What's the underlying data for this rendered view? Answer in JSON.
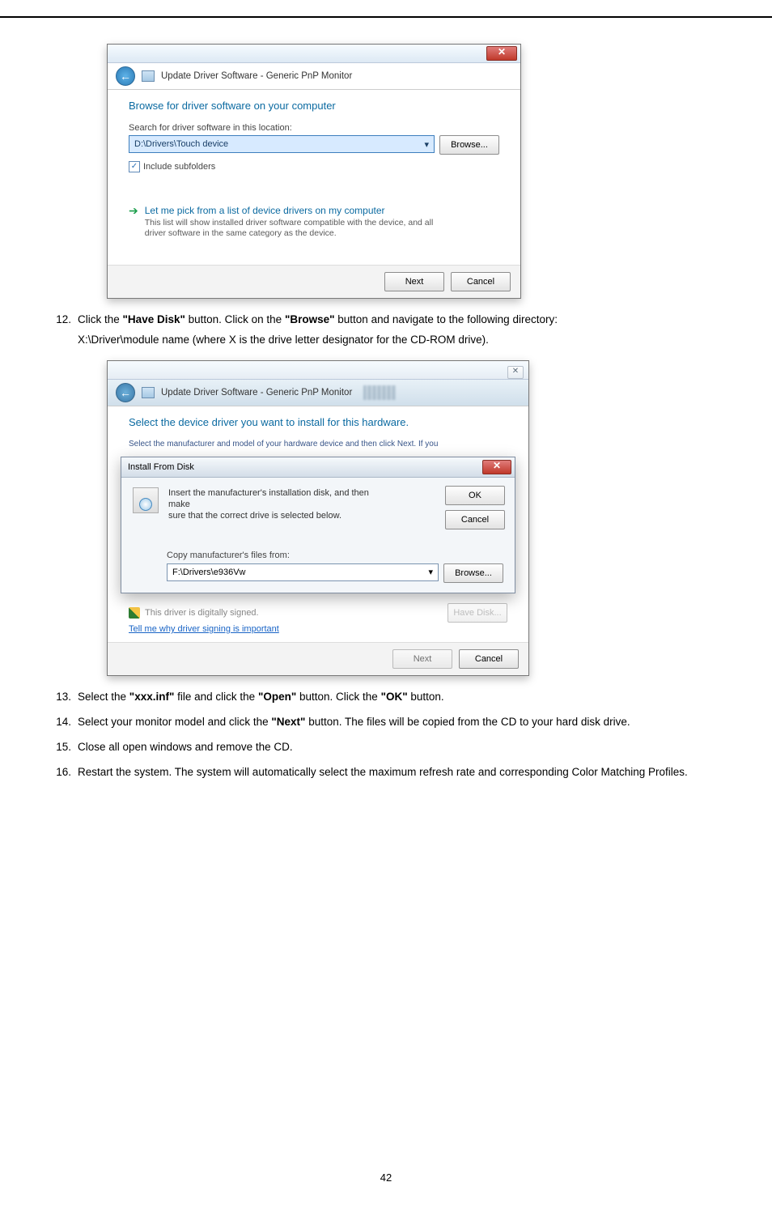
{
  "dlg1": {
    "title": "Update Driver Software - Generic PnP Monitor",
    "heading": "Browse for driver software on your computer",
    "search_label": "Search for driver software in this location:",
    "path": "D:\\Drivers\\Touch device",
    "browse": "Browse...",
    "include": "Include subfolders",
    "opt_title": "Let me pick from a list of device drivers on my computer",
    "opt_desc1": "This list will show installed driver software compatible with the device, and all",
    "opt_desc2": "driver software in the same category as the device.",
    "next": "Next",
    "cancel": "Cancel"
  },
  "dlg2": {
    "title": "Update Driver Software - Generic PnP Monitor",
    "heading": "Select the device driver you want to install for this hardware.",
    "head_hint": "Select the manufacturer and model of your hardware device and then click Next. If you",
    "sub_title": "Install From Disk",
    "sub_msg1": "Insert the manufacturer's installation disk, and then make",
    "sub_msg2": "sure that the correct drive is selected below.",
    "ok": "OK",
    "cancel": "Cancel",
    "copy_label": "Copy manufacturer's files from:",
    "copy_path": "F:\\Drivers\\e936Vw",
    "browse": "Browse...",
    "signed": "This driver is digitally signed.",
    "link": "Tell me why driver signing is important",
    "have_disk": "Have Disk...",
    "next": "Next",
    "cancel2": "Cancel"
  },
  "steps": {
    "s12a": "Click the ",
    "s12b": "\"Have Disk\"",
    "s12c": " button. Click on the ",
    "s12d": "\"Browse\"",
    "s12e": " button and navigate to the following directory:",
    "s12f": "X:\\Driver\\module name (where X is the drive letter designator for the CD-ROM drive).",
    "s13a": "Select the ",
    "s13b": "\"xxx.inf\"",
    "s13c": " file and click the ",
    "s13d": "\"Open\"",
    "s13e": " button. Click the ",
    "s13f": "\"OK\"",
    "s13g": " button.",
    "s14a": "Select your monitor model and click the ",
    "s14b": "\"Next\"",
    "s14c": " button. The files will be copied from the CD to your hard disk drive.",
    "s15": "Close all open windows and remove the CD.",
    "s16": "Restart the system. The system will automatically select the maximum refresh rate and corresponding Color Matching Profiles."
  },
  "page_number": "42"
}
